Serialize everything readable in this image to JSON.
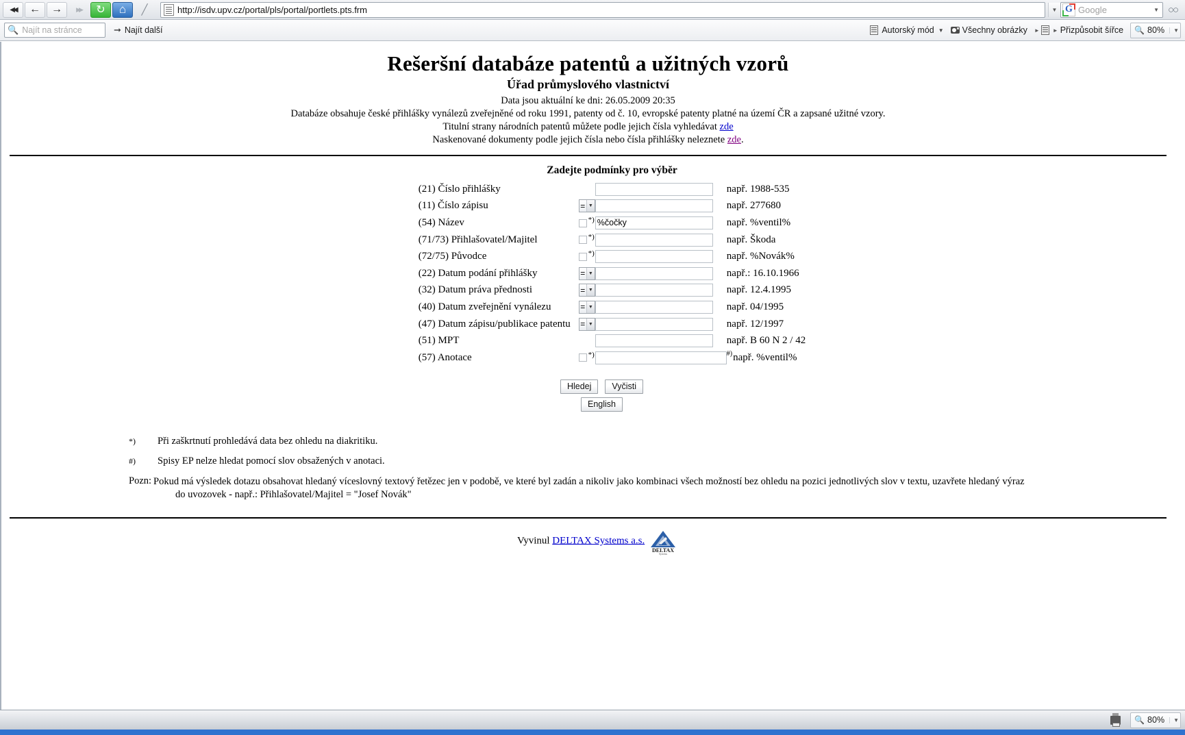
{
  "browser": {
    "nav_buttons": [
      {
        "name": "back-all",
        "glyph": "◀◀"
      },
      {
        "name": "back",
        "glyph": "←"
      },
      {
        "name": "forward",
        "glyph": "→"
      },
      {
        "name": "forward-all",
        "glyph": "▶▶"
      },
      {
        "name": "reload",
        "glyph": "↻"
      },
      {
        "name": "home",
        "glyph": "⌂"
      },
      {
        "name": "edit",
        "glyph": "╱"
      }
    ],
    "url": "http://isdv.upv.cz/portal/pls/portal/portlets.pts.frm",
    "search_placeholder": "Google",
    "find": {
      "placeholder": "Najít na stránce",
      "next_label": "Najít další"
    },
    "toolbar": {
      "author_mode": "Autorský mód",
      "all_images": "Všechny obrázky",
      "fit_width": "Přizpůsobit šířce",
      "zoom": "80%"
    },
    "status": {
      "zoom": "80%"
    }
  },
  "page": {
    "title": "Rešeršní databáze patentů a užitných vzorů",
    "subtitle": "Úřad průmyslového vlastnictví",
    "data_current": "Data jsou aktuální ke dni: 26.05.2009 20:35",
    "desc": "Databáze obsahuje české přihlášky vynálezů zveřejněné od roku 1991, patenty od č. 10, evropské patenty platné na území ČR a zapsané užitné vzory.",
    "line_titul_pre": "Titulní strany národních patentů můžete podle jejich čísla vyhledávat ",
    "line_titul_link": "zde",
    "line_scan_pre": "Naskenované dokumenty podle jejich čísla nebo čísla přihlášky neleznete ",
    "line_scan_link": "zde",
    "line_scan_post": ".",
    "form_heading": "Zadejte podmínky pro výběr",
    "rows": [
      {
        "label": "(21) Číslo přihlášky",
        "control": "none",
        "op": "",
        "checkbox": false,
        "mark": "",
        "value": "",
        "hint": "např. 1988-535"
      },
      {
        "label": "(11) Číslo zápisu",
        "control": "select",
        "op": "=",
        "checkbox": false,
        "mark": "",
        "value": "",
        "hint": "např. 277680"
      },
      {
        "label": "(54) Název",
        "control": "checkbox",
        "op": "",
        "checkbox": true,
        "mark": "*)",
        "value": "%čočky",
        "hint": "např. %ventil%"
      },
      {
        "label": "(71/73) Přihlašovatel/Majitel",
        "control": "checkbox",
        "op": "",
        "checkbox": true,
        "mark": "*)",
        "value": "",
        "hint": "např. Škoda"
      },
      {
        "label": "(72/75) Původce",
        "control": "checkbox",
        "op": "",
        "checkbox": true,
        "mark": "*)",
        "value": "",
        "hint": "např. %Novák%"
      },
      {
        "label": "(22) Datum podání přihlášky",
        "control": "select",
        "op": "=",
        "checkbox": false,
        "mark": "",
        "value": "",
        "hint": "např.: 16.10.1966"
      },
      {
        "label": "(32) Datum práva přednosti",
        "control": "select",
        "op": "=",
        "checkbox": false,
        "mark": "",
        "value": "",
        "hint": "např. 12.4.1995"
      },
      {
        "label": "(40) Datum zveřejnění vynálezu",
        "control": "select",
        "op": "=",
        "checkbox": false,
        "mark": "",
        "value": "",
        "hint": "např. 04/1995"
      },
      {
        "label": "(47) Datum zápisu/publikace patentu",
        "control": "select",
        "op": "=",
        "checkbox": false,
        "mark": "",
        "value": "",
        "hint": "např. 12/1997"
      },
      {
        "label": "(51) MPT",
        "control": "none",
        "op": "",
        "checkbox": false,
        "mark": "",
        "value": "",
        "hint": "např. B 60 N 2 / 42"
      },
      {
        "label": "(57) Anotace",
        "control": "checkbox",
        "op": "",
        "checkbox": true,
        "mark": "*)",
        "value": "",
        "hint": "např. %ventil%",
        "hint_mark": "#)"
      }
    ],
    "buttons": {
      "search": "Hledej",
      "clear": "Vyčisti",
      "english": "English"
    },
    "notes": [
      {
        "mark": "*)",
        "text": "Při zaškrtnutí prohledává data bez ohledu na diakritiku.",
        "indent": ""
      },
      {
        "mark": "#)",
        "text": "Spisy EP nelze hledat pomocí slov obsažených v anotaci.",
        "indent": ""
      },
      {
        "mark": "Pozn:",
        "text": "Pokud má výsledek dotazu obsahovat hledaný víceslovný textový řetězec jen v podobě, ve které byl zadán a nikoliv jako kombinaci všech možností bez ohledu na pozici jednotlivých slov v textu, uzavřete hledaný výraz",
        "indent": "do uvozovek - např.: Přihlašovatel/Majitel = \"Josef Novák\""
      }
    ],
    "footer": {
      "pre": "Vyvinul ",
      "link": "DELTAX Systems a.s.",
      "logo_text": "DELTAX",
      "logo_sub": "Systems"
    }
  }
}
